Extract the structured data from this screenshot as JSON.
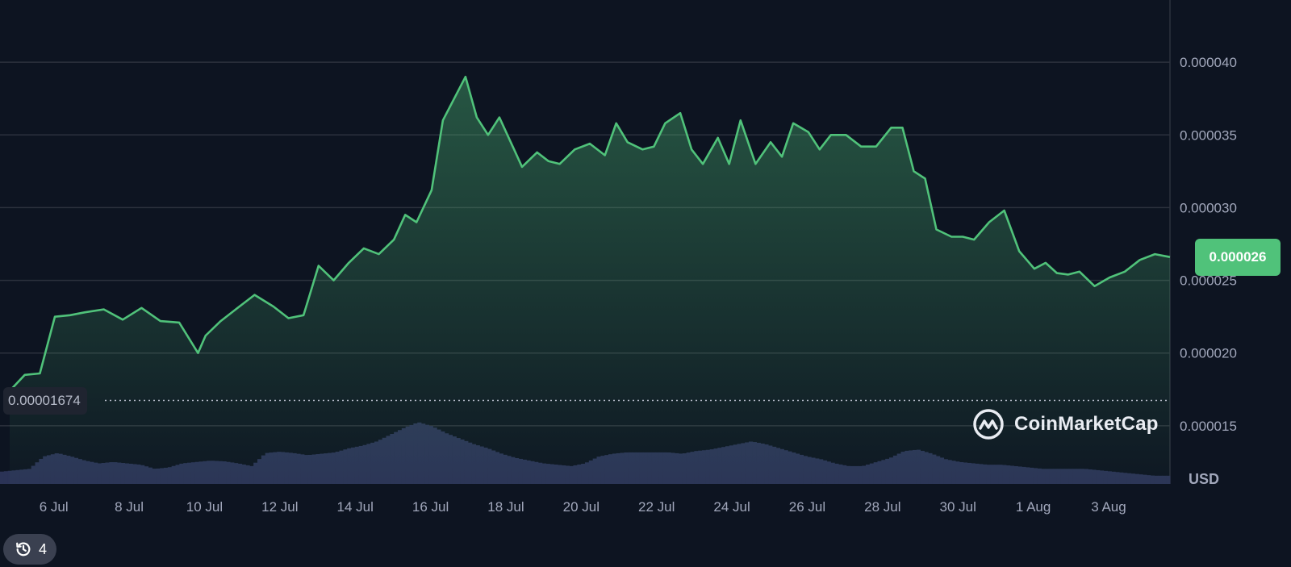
{
  "chart_data": {
    "type": "area",
    "title": "",
    "currency": "USD",
    "open_price_label": "0.00001674",
    "open_price": 1.674e-05,
    "current_price_label": "0.000026",
    "current_price": 2.64e-05,
    "ylim": [
      1.1e-05,
      4.4e-05
    ],
    "y_ticks": [
      "0.000040",
      "0.000035",
      "0.000030",
      "0.000025",
      "0.000020",
      "0.000015"
    ],
    "y_tick_values": [
      4e-05,
      3.5e-05,
      3e-05,
      2.5e-05,
      2e-05,
      1.5e-05
    ],
    "x_ticks": [
      "6 Jul",
      "8 Jul",
      "10 Jul",
      "12 Jul",
      "14 Jul",
      "16 Jul",
      "18 Jul",
      "20 Jul",
      "22 Jul",
      "24 Jul",
      "26 Jul",
      "28 Jul",
      "30 Jul",
      "1 Aug",
      "3 Aug"
    ],
    "x_tick_dayoffset": [
      1,
      3,
      5,
      7,
      9,
      11,
      13,
      15,
      17,
      19,
      21,
      23,
      25,
      27,
      29
    ],
    "grid": "horizontal",
    "series": [
      {
        "values_day_offset": [
          0,
          0.4,
          0.8,
          1.2,
          1.6,
          2.0,
          2.5,
          3.0,
          3.5,
          4.0,
          4.5,
          5.0,
          5.2,
          5.6,
          6.0,
          6.5,
          7.0,
          7.4,
          7.8,
          8.2,
          8.6,
          9.0,
          9.4,
          9.8,
          10.2,
          10.5,
          10.8,
          11.2,
          11.5,
          11.8,
          12.1,
          12.4,
          12.7,
          13.0,
          13.3,
          13.6,
          14.0,
          14.3,
          14.6,
          15.0,
          15.4,
          15.8,
          16.1,
          16.4,
          16.8,
          17.1,
          17.4,
          17.8,
          18.1,
          18.4,
          18.8,
          19.1,
          19.4,
          19.8,
          20.2,
          20.5,
          20.8,
          21.2,
          21.5,
          21.8,
          22.2,
          22.6,
          23.0,
          23.4,
          23.7,
          24.0,
          24.3,
          24.6,
          25.0,
          25.3,
          25.6,
          26.0,
          26.4,
          26.8,
          27.2,
          27.5,
          27.8,
          28.1,
          28.4,
          28.8,
          29.2,
          29.6,
          30.0,
          30.4,
          30.8
        ],
        "price": [
          1.74e-05,
          1.85e-05,
          1.86e-05,
          2.25e-05,
          2.26e-05,
          2.28e-05,
          2.3e-05,
          2.23e-05,
          2.31e-05,
          2.22e-05,
          2.21e-05,
          2e-05,
          2.12e-05,
          2.22e-05,
          2.3e-05,
          2.4e-05,
          2.32e-05,
          2.24e-05,
          2.26e-05,
          2.6e-05,
          2.5e-05,
          2.62e-05,
          2.72e-05,
          2.68e-05,
          2.78e-05,
          2.95e-05,
          2.9e-05,
          3.12e-05,
          3.6e-05,
          3.75e-05,
          3.9e-05,
          3.62e-05,
          3.5e-05,
          3.62e-05,
          3.45e-05,
          3.28e-05,
          3.38e-05,
          3.32e-05,
          3.3e-05,
          3.4e-05,
          3.44e-05,
          3.36e-05,
          3.58e-05,
          3.45e-05,
          3.4e-05,
          3.42e-05,
          3.58e-05,
          3.65e-05,
          3.4e-05,
          3.3e-05,
          3.48e-05,
          3.3e-05,
          3.6e-05,
          3.3e-05,
          3.45e-05,
          3.35e-05,
          3.58e-05,
          3.52e-05,
          3.4e-05,
          3.5e-05,
          3.5e-05,
          3.42e-05,
          3.42e-05,
          3.55e-05,
          3.55e-05,
          3.25e-05,
          3.2e-05,
          2.85e-05,
          2.8e-05,
          2.8e-05,
          2.78e-05,
          2.9e-05,
          2.98e-05,
          2.7e-05,
          2.58e-05,
          2.62e-05,
          2.55e-05,
          2.54e-05,
          2.56e-05,
          2.46e-05,
          2.52e-05,
          2.56e-05,
          2.64e-05,
          2.68e-05,
          2.66e-05
        ]
      }
    ],
    "volume_relative": [
      0.18,
      0.2,
      0.22,
      0.4,
      0.45,
      0.4,
      0.34,
      0.3,
      0.32,
      0.3,
      0.28,
      0.22,
      0.24,
      0.3,
      0.32,
      0.34,
      0.33,
      0.3,
      0.26,
      0.45,
      0.47,
      0.45,
      0.42,
      0.44,
      0.46,
      0.52,
      0.56,
      0.62,
      0.72,
      0.82,
      0.9,
      0.84,
      0.74,
      0.66,
      0.58,
      0.52,
      0.44,
      0.38,
      0.34,
      0.3,
      0.28,
      0.26,
      0.3,
      0.4,
      0.44,
      0.46,
      0.46,
      0.46,
      0.46,
      0.44,
      0.48,
      0.5,
      0.54,
      0.58,
      0.62,
      0.58,
      0.52,
      0.46,
      0.4,
      0.36,
      0.3,
      0.26,
      0.26,
      0.32,
      0.38,
      0.48,
      0.5,
      0.44,
      0.36,
      0.32,
      0.3,
      0.28,
      0.28,
      0.26,
      0.24,
      0.22,
      0.22,
      0.22,
      0.22,
      0.2,
      0.18,
      0.16,
      0.14,
      0.12,
      0.12
    ]
  },
  "chart_text": {
    "brand": "CoinMarketCap",
    "unit": "USD",
    "history_count": "4",
    "open_price_label": "0.00001674",
    "current_price_label": "0.000026"
  },
  "colors": {
    "background": "#0d1421",
    "line": "#50c27a",
    "volume": "#2b3356",
    "grid": "#2c313d"
  },
  "icons": {
    "history": "history-clock-icon",
    "logo": "coinmarketcap-logo-icon"
  }
}
